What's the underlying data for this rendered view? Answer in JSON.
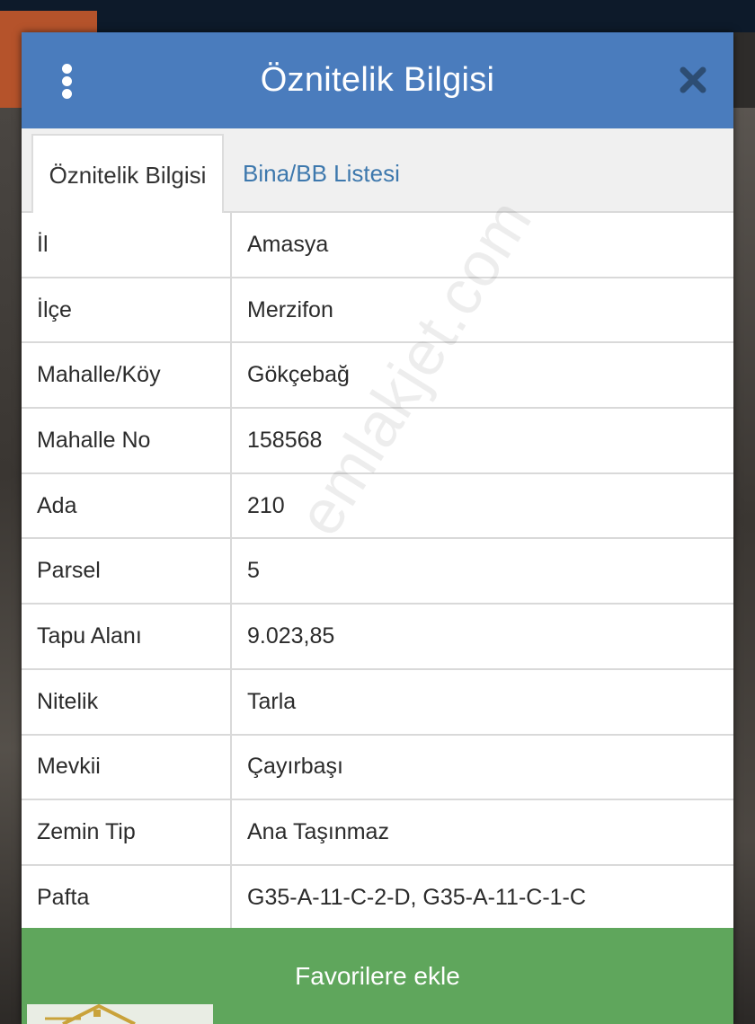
{
  "dialog": {
    "title": "Öznitelik Bilgisi",
    "menu_icon": "vertical-dots-icon",
    "close_icon": "close-icon"
  },
  "tabs": [
    {
      "label": "Öznitelik Bilgisi",
      "active": true
    },
    {
      "label": "Bina/BB Listesi",
      "active": false
    }
  ],
  "attributes": [
    {
      "label": "İl",
      "value": "Amasya"
    },
    {
      "label": "İlçe",
      "value": "Merzifon"
    },
    {
      "label": "Mahalle/Köy",
      "value": "Gökçebağ"
    },
    {
      "label": "Mahalle No",
      "value": "158568"
    },
    {
      "label": "Ada",
      "value": "210"
    },
    {
      "label": "Parsel",
      "value": "5"
    },
    {
      "label": "Tapu Alanı",
      "value": "9.023,85"
    },
    {
      "label": "Nitelik",
      "value": "Tarla"
    },
    {
      "label": "Mevkii",
      "value": "Çayırbaşı"
    },
    {
      "label": "Zemin Tip",
      "value": "Ana Taşınmaz"
    },
    {
      "label": "Pafta",
      "value": "G35-A-11-C-2-D, G35-A-11-C-1-C"
    }
  ],
  "footer": {
    "favorite_label": "Favorilere ekle"
  },
  "watermark": "emlakjet.com",
  "colors": {
    "header": "#4a7cbd",
    "button": "#5fa65c",
    "tab_link": "#3d78ad"
  }
}
